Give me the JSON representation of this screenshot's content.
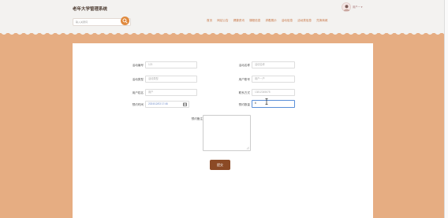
{
  "header": {
    "site_title": "老年大学管理系统",
    "search_placeholder": "输入关键词",
    "username": "用户一 ▾"
  },
  "nav": [
    "首页",
    "网站公告",
    "健康资讯",
    "课程信息",
    "求着展示",
    "活动信息",
    "活动类信息",
    "兑换商城"
  ],
  "form": {
    "activity_no_label": "活动编号",
    "activity_no_value": "123",
    "activity_name_label": "活动名称",
    "activity_name_value": "活动名称",
    "activity_type_label": "活动类型",
    "activity_type_value": "活动类型",
    "account_label": "用户账号",
    "account_value": "用户一户",
    "user_name_label": "用户姓名",
    "user_name_value": "用户",
    "phone_label": "联系方式",
    "phone_value": "13812345678",
    "reserve_time_label": "预约时间",
    "reserve_time_value": "2024/12/03 17:46",
    "reserve_count_label": "预约数量",
    "reserve_count_value": "6",
    "remark_label": "预约备注",
    "submit_label": "提交"
  },
  "colors": {
    "background": "#e6ad82",
    "accent": "#e08a3e",
    "submit": "#8b4a25",
    "nav_text": "#c97747"
  }
}
